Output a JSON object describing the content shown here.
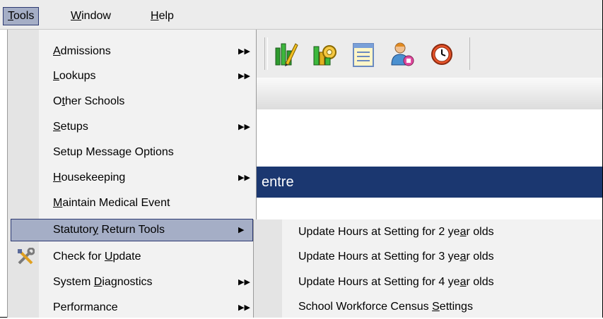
{
  "menubar": {
    "items": [
      {
        "label": "Tools",
        "mnemonic_index": 0
      },
      {
        "label": "Window",
        "mnemonic_index": 0
      },
      {
        "label": "Help",
        "mnemonic_index": 0
      }
    ],
    "active": "Tools"
  },
  "toolbar": {
    "icons": [
      "pencil-chart-icon",
      "gear-chart-icon",
      "report-sheet-icon",
      "user-group-icon",
      "clock-icon"
    ]
  },
  "banner": {
    "text": "entre"
  },
  "tools_menu": {
    "items": [
      {
        "label": "Admissions",
        "mnemonic_index": 0,
        "submenu": true
      },
      {
        "label": "Lookups",
        "mnemonic_index": 0,
        "submenu": true
      },
      {
        "label": "Other Schools",
        "mnemonic_index": 1,
        "submenu": false
      },
      {
        "label": "Setups",
        "mnemonic_index": 0,
        "submenu": true
      },
      {
        "label": "Setup Message Options",
        "mnemonic_index": -1,
        "submenu": false
      },
      {
        "label": "Housekeeping",
        "mnemonic_index": 0,
        "submenu": true
      },
      {
        "label": "Maintain Medical Event",
        "mnemonic_index": 0,
        "submenu": false
      },
      {
        "label": "Statutory Return Tools",
        "mnemonic_index": 8,
        "submenu": true,
        "highlighted": true
      },
      {
        "label": "Check for Update",
        "mnemonic_index": 10,
        "submenu": false,
        "icon": "tools-icon"
      },
      {
        "label": "System Diagnostics",
        "mnemonic_index": 7,
        "submenu": true
      },
      {
        "label": "Performance",
        "mnemonic_index": -1,
        "submenu": true
      }
    ]
  },
  "statutory_submenu": {
    "items": [
      {
        "label": "Update Hours at Setting for 2 year olds",
        "mnemonic_index": 32
      },
      {
        "label": "Update Hours at Setting for 3 year olds",
        "mnemonic_index": 32
      },
      {
        "label": "Update Hours at Setting for 4 year olds",
        "mnemonic_index": 32
      },
      {
        "label": "School Workforce Census Settings",
        "mnemonic_index": 24
      }
    ]
  },
  "colors": {
    "highlight_bg": "#a5aec6",
    "highlight_border": "#2d3a72",
    "banner_bg": "#1b3770",
    "menu_bg": "#f2f2f2",
    "menubar_bg": "#ececec"
  }
}
